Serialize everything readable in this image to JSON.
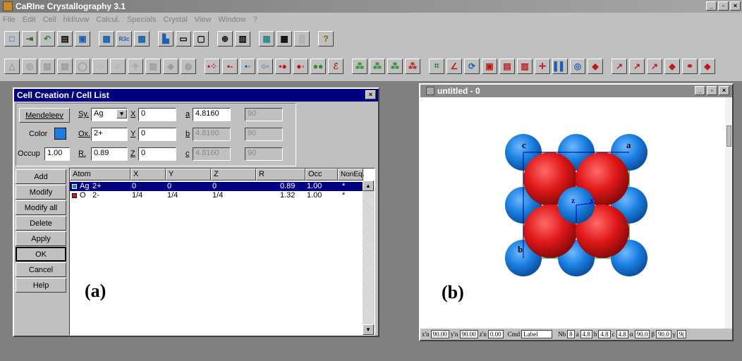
{
  "app": {
    "title": "CaRIne Crystallography 3.1",
    "win_min": "_",
    "win_max": "▫",
    "win_close": "×"
  },
  "menu": [
    "File",
    "Edit",
    "Cell",
    "hkl/uvw",
    "Calcul.",
    "Specials",
    "Crystal",
    "View",
    "Window",
    "?"
  ],
  "dialog": {
    "title": "Cell Creation / Cell List",
    "close": "×",
    "mendeleev_label": "Mendeleev",
    "sy_label": "Sy.",
    "sy_value": "Ag",
    "color_label": "Color",
    "color_value": "#1a7fe0",
    "ox_label": "Ox.",
    "ox_value": "2+",
    "occup_label": "Occup",
    "occup_value": "1.00",
    "r_label": "R.",
    "r_value": "0.89",
    "x_label": "X",
    "x_value": "0",
    "y_label": "Y",
    "y_value": "0",
    "z_label": "Z",
    "z_value": "0",
    "a_label": "a",
    "a_value": "4.8160",
    "b_label": "b",
    "b_value": "4.8160",
    "c_label": "c",
    "c_value": "4.8160",
    "alpha_value": "90",
    "beta_value": "90",
    "gamma_value": "90",
    "buttons": [
      "Add",
      "Modify",
      "Modify all",
      "Delete",
      "Apply",
      "OK",
      "Cancel",
      "Help"
    ],
    "columns": [
      "Atom",
      "X",
      "Y",
      "Z",
      "R",
      "Occ",
      "NonEq."
    ],
    "rows": [
      {
        "atom": "Ag",
        "ox": "2+",
        "x": "0",
        "y": "0",
        "z": "0",
        "r": "0.89",
        "occ": "1.00",
        "noneq": "*",
        "color": "#1a7fe0"
      },
      {
        "atom": "O",
        "ox": "2-",
        "x": "1/4",
        "y": "1/4",
        "z": "1/4",
        "r": "1.32",
        "occ": "1.00",
        "noneq": "*",
        "color": "#cc1a1a"
      }
    ],
    "figure_label": "(a)"
  },
  "view": {
    "title": "untitled - 0",
    "figure_label": "(b)",
    "axis_labels": {
      "a": "a",
      "b": "b",
      "c": "c",
      "z": "z",
      "x": "x"
    },
    "status": {
      "xn": "x'n",
      "xn_val": "90.00",
      "yn": "y'n",
      "yn_val": "90.00",
      "zn": "z'n",
      "zn_val": "0.00",
      "cmd": "Cmd",
      "cmd_val": "Label",
      "nb": "Nb",
      "nb_val": "8",
      "a": "a",
      "a_val": "4.8",
      "b": "b",
      "b_val": "4.8",
      "c": "c",
      "c_val": "4.8",
      "alpha": "α",
      "alpha_val": "90.0",
      "beta": "β",
      "beta_val": "90.0",
      "gamma": "γ",
      "gamma_val": "9("
    }
  },
  "colors": {
    "silver_atom": "#1a7fe0",
    "oxygen_atom": "#cc1a1a",
    "dialog_title": "#000080"
  }
}
